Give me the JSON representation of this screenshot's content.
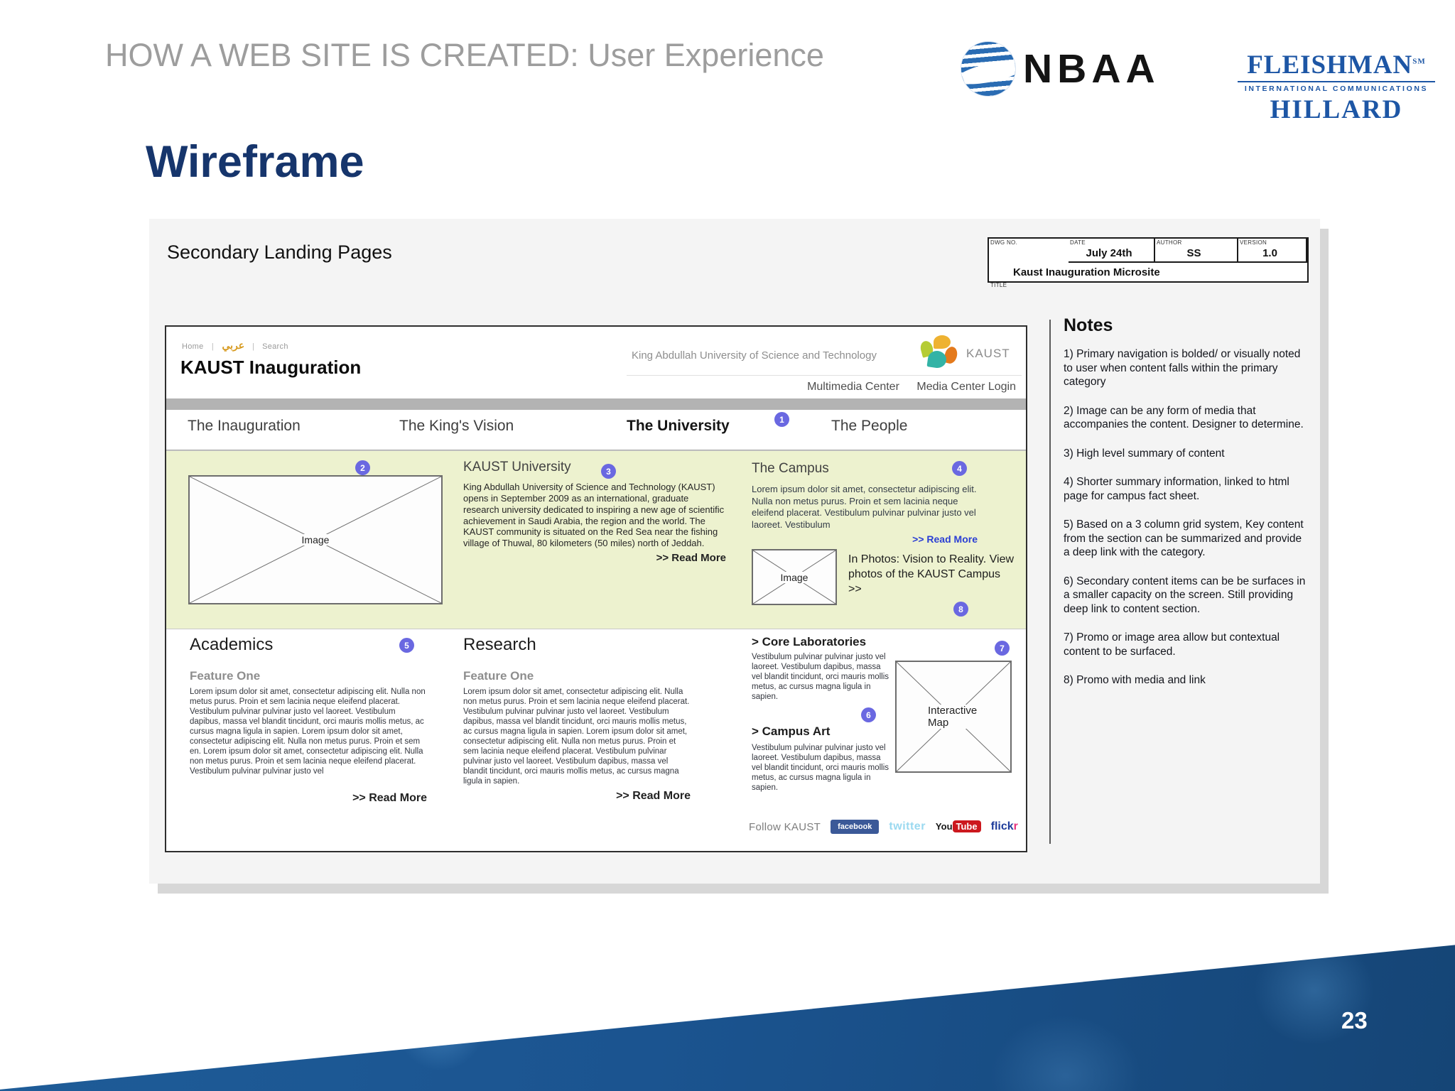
{
  "slide": {
    "header_title": "HOW A WEB SITE IS CREATED: User Experience",
    "title": "Wireframe",
    "subtitle": "Secondary Landing Pages",
    "page_number": "23"
  },
  "logos": {
    "nbaa": "NBAA",
    "nbaa_globe_icon": "striped-globe-icon",
    "fh_line1": "FLEISHMAN",
    "fh_sm": "SM",
    "fh_line2": "INTERNATIONAL COMMUNICATIONS",
    "fh_line3": "HILLARD"
  },
  "titleblock": {
    "date_label": "DATE",
    "date": "July 24th",
    "author_label": "AUTHOR",
    "author": "SS",
    "version_label": "VERSION",
    "version": "1.0",
    "dwg_label": "DWG NO.",
    "title_label": "TITLE",
    "title": "Kaust Inauguration Microsite"
  },
  "wireframe": {
    "utility_nav": {
      "home": "Home",
      "sep": "|",
      "arabic": "عربي",
      "search": "Search"
    },
    "site_title": "KAUST Inauguration",
    "university_name": "King Abdullah University of Science and Technology",
    "kaust_logo_text": "KAUST",
    "links": {
      "multimedia": "Multimedia Center",
      "login": "Media Center Login"
    },
    "tabs": [
      {
        "label": "The Inauguration"
      },
      {
        "label": "The King's Vision"
      },
      {
        "label": "The University",
        "badge": "1"
      },
      {
        "label": "The People"
      }
    ],
    "hero": {
      "image_label": "Image",
      "badge_image": "2",
      "kaust_university": {
        "heading": "KAUST University",
        "badge": "3",
        "body": "King Abdullah University of Science and Technology (KAUST) opens in September 2009 as an international, graduate research university dedicated to inspiring a new age of scientific achievement in Saudi Arabia, the region and the world. The KAUST community is situated on the Red Sea near the fishing village of Thuwal, 80 kilometers (50 miles) north of Jeddah.",
        "read_more": ">> Read More"
      },
      "campus": {
        "heading": "The Campus",
        "badge": "4",
        "body": "Lorem ipsum dolor sit amet, consectetur adipiscing elit. Nulla non metus purus. Proin et sem lacinia neque eleifend placerat. Vestibulum pulvinar pulvinar justo vel laoreet. Vestibulum",
        "read_more": ">> Read More",
        "image_label": "Image",
        "promo": "In Photos: Vision to Reality. View photos of the KAUST Campus >>",
        "badge_promo": "8"
      }
    },
    "columns": {
      "academics": {
        "heading": "Academics",
        "badge": "5",
        "feature": "Feature One",
        "body": "Lorem ipsum dolor sit amet, consectetur adipiscing elit. Nulla non metus purus. Proin et sem lacinia neque eleifend placerat. Vestibulum pulvinar pulvinar justo vel laoreet. Vestibulum dapibus, massa vel blandit tincidunt, orci mauris mollis metus, ac cursus magna ligula in sapien. Lorem ipsum dolor sit amet, consectetur adipiscing elit. Nulla non metus purus. Proin et sem en. Lorem ipsum dolor sit amet, consectetur adipiscing elit. Nulla non metus purus. Proin et sem lacinia neque eleifend placerat. Vestibulum pulvinar pulvinar justo vel",
        "read_more": ">> Read More"
      },
      "research": {
        "heading": "Research",
        "feature": "Feature One",
        "body": "Lorem ipsum dolor sit amet, consectetur adipiscing elit. Nulla non metus purus. Proin et sem lacinia neque eleifend placerat. Vestibulum pulvinar pulvinar justo vel laoreet. Vestibulum dapibus, massa vel blandit tincidunt, orci mauris mollis metus, ac cursus magna ligula in sapien. Lorem ipsum dolor sit amet, consectetur adipiscing elit. Nulla non metus purus. Proin et sem lacinia neque eleifend placerat. Vestibulum pulvinar pulvinar justo vel laoreet. Vestibulum dapibus, massa vel blandit tincidunt, orci mauris mollis metus, ac cursus magna ligula in sapien.",
        "read_more": ">> Read More"
      },
      "secondary": {
        "core_labs_heading": "> Core Laboratories",
        "core_labs_body": "Vestibulum pulvinar pulvinar justo vel laoreet. Vestibulum dapibus, massa vel blandit tincidunt, orci mauris mollis metus, ac cursus magna ligula in sapien.",
        "badge": "6",
        "campus_art_heading": "> Campus Art",
        "campus_art_body": "Vestibulum pulvinar pulvinar justo vel laoreet. Vestibulum dapibus, massa vel blandit tincidunt, orci mauris mollis metus, ac cursus magna ligula in sapien.",
        "map_label": "Interactive Map",
        "badge_map": "7"
      }
    },
    "footer": {
      "follow": "Follow KAUST",
      "facebook": "facebook",
      "twitter": "twitter",
      "youtube_you": "You",
      "youtube_tube": "Tube",
      "flickr_flick": "flick",
      "flickr_r": "r"
    }
  },
  "notes": {
    "heading": "Notes",
    "items": [
      "1) Primary navigation is bolded/ or visually noted to user when content falls within the primary category",
      "2) Image can be any form of media that accompanies the content. Designer to determine.",
      "3) High level summary of content",
      "4) Shorter summary information, linked to html page for campus fact sheet.",
      "5) Based on a 3 column grid system, Key content from the section can be summarized and provide a deep link with the category.",
      "6) Secondary content items can be be surfaces in a smaller capacity on the screen. Still providing deep link to content section.",
      "7) Promo or image area allow but contextual content to be surfaced.",
      "8) Promo with media and link"
    ]
  },
  "colors": {
    "accent_badge": "#6a68e1",
    "hero_band": "#edf2cf",
    "slide_title_navy": "#16356c",
    "fleishman_blue": "#1d56a5",
    "facebook_blue": "#3b5998",
    "twitter_blue": "#9ad9f0",
    "youtube_red": "#cc181e",
    "flickr_blue": "#1e3c9b",
    "flickr_pink": "#e8327c",
    "wedge_blue": "#1b5490",
    "arabic_gold": "#d79a1f"
  }
}
